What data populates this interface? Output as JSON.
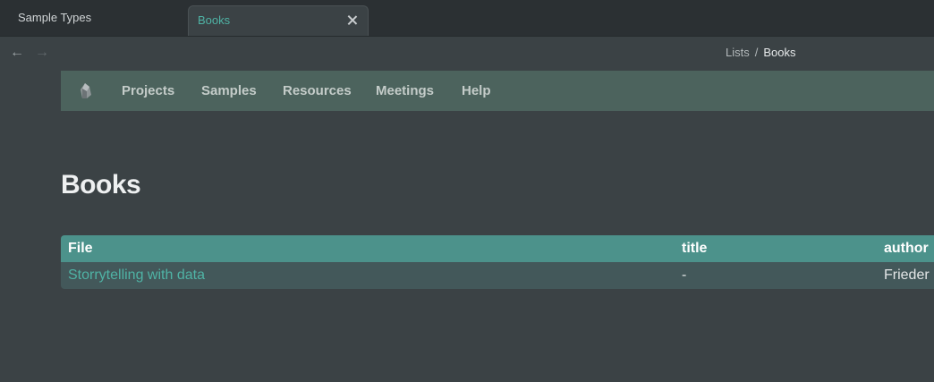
{
  "tabs": [
    {
      "label": "Sample Types"
    },
    {
      "label": "Books"
    }
  ],
  "breadcrumb": {
    "parent": "Lists",
    "separator": "/",
    "current": "Books"
  },
  "menu": {
    "items": [
      "Projects",
      "Samples",
      "Resources",
      "Meetings",
      "Help"
    ]
  },
  "page": {
    "title": "Books"
  },
  "table": {
    "columns": [
      "File",
      "title",
      "author"
    ],
    "rows": [
      {
        "file": "Storrytelling with data",
        "title": "-",
        "author": "Frieder"
      }
    ]
  },
  "icons": {
    "back": "arrow-left-icon",
    "forward": "arrow-right-icon",
    "close": "close-icon",
    "logo": "app-logo-icon"
  },
  "colors": {
    "accent": "#4fb3a5",
    "menubar": "#4c635d",
    "table_header": "#4c928b"
  }
}
